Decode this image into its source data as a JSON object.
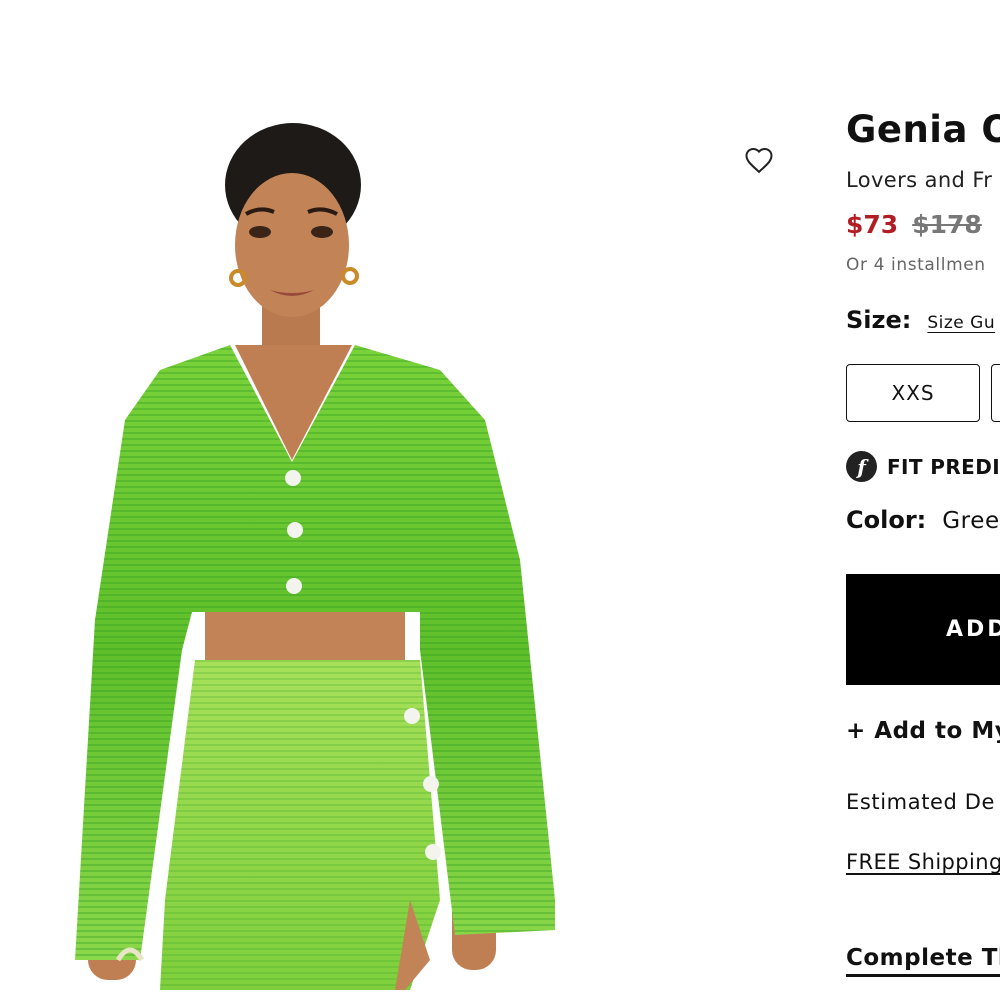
{
  "product": {
    "title": "Genia O",
    "brand": "Lovers and Fr",
    "price_sale": "$73",
    "price_original": "$178",
    "installments": "Or 4 installmen",
    "size_label": "Size:",
    "size_guide": "Size Gu",
    "sizes": [
      "XXS",
      ""
    ],
    "fit_icon": "f",
    "fit_label": "FIT PREDIC",
    "color_label": "Color:",
    "color_value": "Gree",
    "add_button": "ADD",
    "add_to_list": "+ Add to My",
    "estimated_delivery": "Estimated De",
    "free_shipping": "FREE Shipping",
    "complete_look": "Complete Th"
  },
  "icons": {
    "wishlist": "heart-outline-icon",
    "fit": "fit-predictor-logo-icon"
  },
  "colors": {
    "sale_price": "#b21d25",
    "original_price": "#777777",
    "button": "#000000",
    "garment": "#6cc92e"
  }
}
